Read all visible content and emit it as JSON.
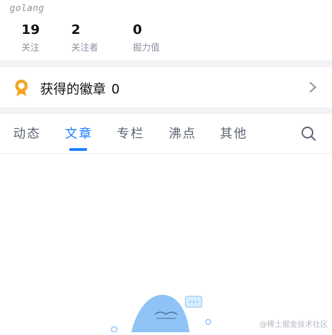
{
  "profile": {
    "username": "golang"
  },
  "stats": [
    {
      "value": "19",
      "label": "关注"
    },
    {
      "value": "2",
      "label": "关注者"
    },
    {
      "value": "0",
      "label": "掘力值"
    }
  ],
  "badges": {
    "label": "获得的徽章",
    "count": "0"
  },
  "tabs": [
    {
      "label": "动态"
    },
    {
      "label": "文章"
    },
    {
      "label": "专栏"
    },
    {
      "label": "沸点"
    },
    {
      "label": "其他"
    }
  ],
  "active_tab": "文章",
  "watermark": "@稀土掘金技术社区",
  "colors": {
    "accent": "#1e80ff",
    "badge": "#f5a623",
    "empty_illustration": "#8fc3f5"
  },
  "icons": [
    "badge-medal-icon",
    "chevron-right-icon",
    "search-icon"
  ]
}
